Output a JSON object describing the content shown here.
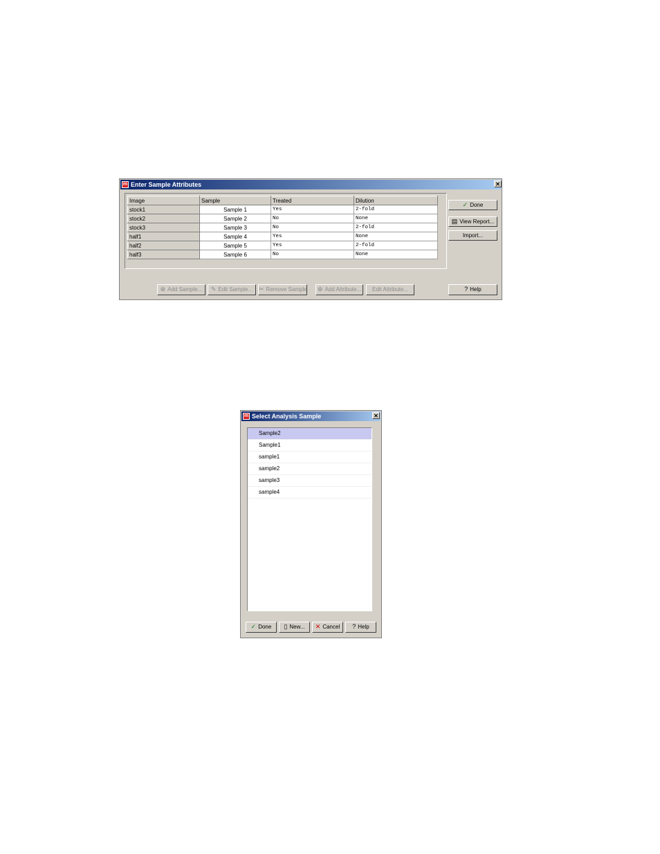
{
  "dialog1": {
    "title": "Enter Sample Attributes",
    "close": "✕",
    "columns": [
      "Image",
      "Sample",
      "Treated",
      "Dilution"
    ],
    "rows": [
      {
        "image": "stock1",
        "sample": "Sample 1",
        "treated": "Yes",
        "dilution": "2-fold"
      },
      {
        "image": "stock2",
        "sample": "Sample 2",
        "treated": "No",
        "dilution": "None"
      },
      {
        "image": "stock3",
        "sample": "Sample 3",
        "treated": "No",
        "dilution": "2-fold"
      },
      {
        "image": "half1",
        "sample": "Sample 4",
        "treated": "Yes",
        "dilution": "None"
      },
      {
        "image": "half2",
        "sample": "Sample 5",
        "treated": "Yes",
        "dilution": "2-fold"
      },
      {
        "image": "half3",
        "sample": "Sample 6",
        "treated": "No",
        "dilution": "None"
      }
    ],
    "buttons": {
      "done": "Done",
      "view_report": "View Report...",
      "import": "Import...",
      "add_sample": "Add Sample...",
      "edit_sample": "Edit Sample...",
      "remove_sample": "Remove Sample",
      "add_attribute": "Add Attribute...",
      "edit_attribute": "Edit Attribute...",
      "help": "Help"
    }
  },
  "dialog2": {
    "title": "Select Analysis Sample",
    "close": "✕",
    "items": [
      "Sample2",
      "Sample1",
      "sample1",
      "sample2",
      "sample3",
      "sample4"
    ],
    "selected_index": 0,
    "buttons": {
      "done": "Done",
      "new": "New...",
      "cancel": "Cancel",
      "help": "Help"
    }
  }
}
